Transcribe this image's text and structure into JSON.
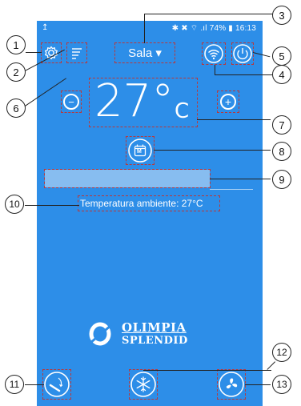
{
  "status_bar": {
    "left_icon": "upload-arrow",
    "right_text": "✱ ✖ ⌔ .ıl 74% ▮ 16:13"
  },
  "room_selector": {
    "label": "Sala ▾"
  },
  "temperature": {
    "value": "27°",
    "unit": "C"
  },
  "mode_icon": {
    "letter": "M"
  },
  "ambient": {
    "text": "Temperatura ambiente: 27°C"
  },
  "brand": {
    "line1": "OLIMPIA",
    "line2": "SPLENDID"
  },
  "buttons": {
    "minus": "−",
    "plus": "+"
  },
  "callouts": [
    "1",
    "2",
    "3",
    "4",
    "5",
    "6",
    "7",
    "8",
    "9",
    "10",
    "11",
    "12",
    "13"
  ],
  "colors": {
    "background": "#2d8ee8",
    "foreground": "#ffffff",
    "highlight": "#b8393c"
  }
}
